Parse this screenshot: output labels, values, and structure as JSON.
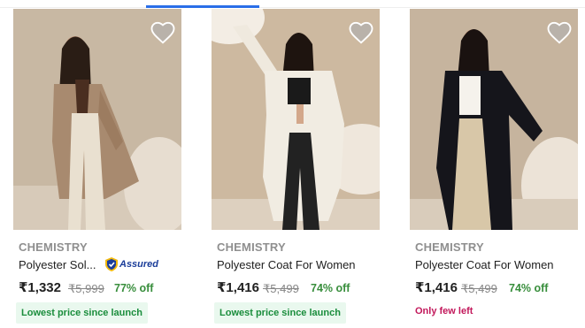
{
  "products": [
    {
      "brand": "CHEMISTRY",
      "name": "Polyester Sol...",
      "assured_label": "Assured",
      "price": "₹1,332",
      "mrp": "₹5,999",
      "discount": "77% off",
      "tag": "Lowest price since launch"
    },
    {
      "brand": "CHEMISTRY",
      "name": "Polyester Coat For Women",
      "price": "₹1,416",
      "mrp": "₹5,499",
      "discount": "74% off",
      "tag": "Lowest price since launch"
    },
    {
      "brand": "CHEMISTRY",
      "name": "Polyester Coat For Women",
      "price": "₹1,416",
      "mrp": "₹5,499",
      "discount": "74% off",
      "stock_note": "Only few left"
    }
  ],
  "colors": {
    "accent": "#2a6ee8",
    "discount": "#388e3c",
    "badge_bg": "#e9f8ee",
    "badge_text": "#1a8d3c",
    "stock_warning": "#c2185b"
  },
  "icons": {
    "wishlist": "heart-icon",
    "assured": "assured-shield-icon"
  }
}
